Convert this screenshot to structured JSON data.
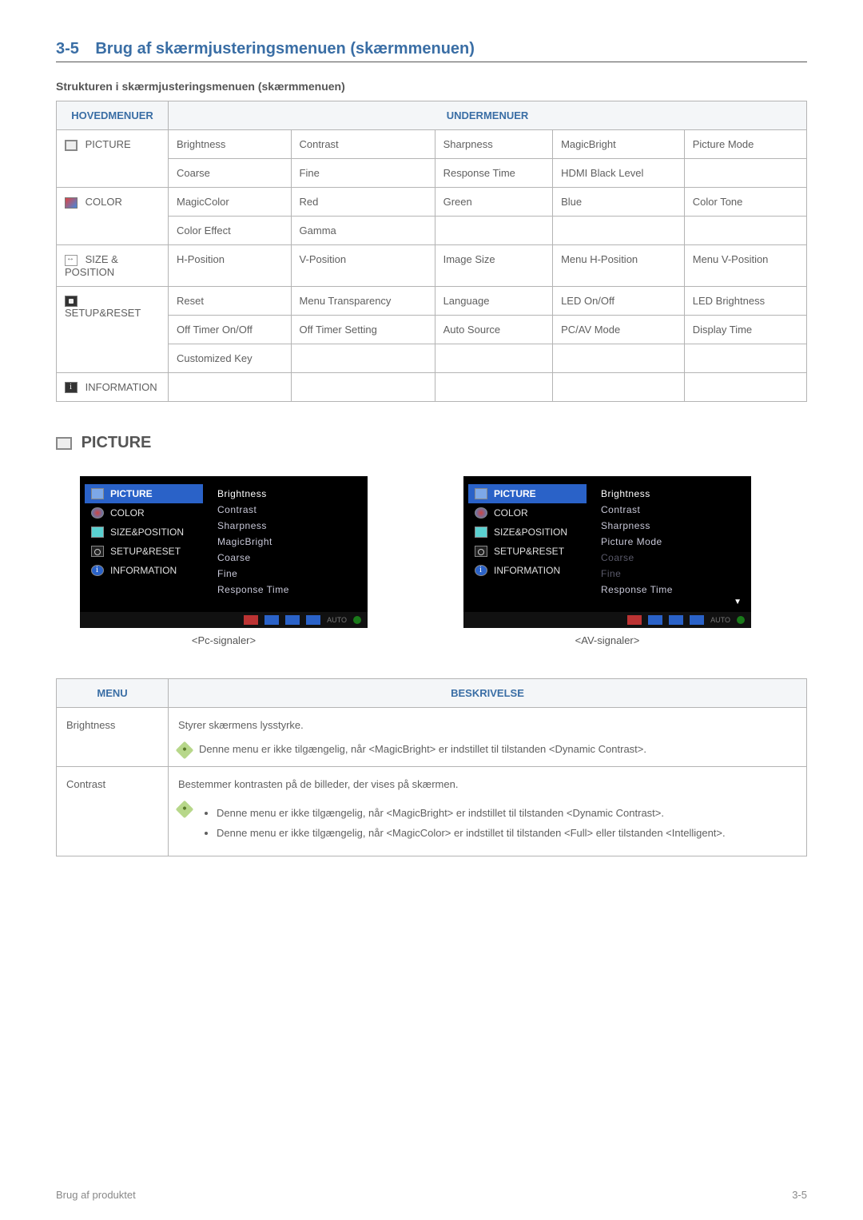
{
  "section": {
    "num": "3-5",
    "title": "Brug af skærmjusteringsmenuen (skærmmenuen)"
  },
  "subheading": "Strukturen i skærmjusteringsmenuen (skærmmenuen)",
  "table1": {
    "head": {
      "col1": "HOVEDMENUER",
      "col2": "UNDERMENUER"
    },
    "rows": {
      "picture_label": "PICTURE",
      "picture_r1": [
        "Brightness",
        "Contrast",
        "Sharpness",
        "MagicBright",
        "Picture Mode"
      ],
      "picture_r2": [
        "Coarse",
        "Fine",
        "Response Time",
        "HDMI Black Level",
        ""
      ],
      "color_label": "COLOR",
      "color_r1": [
        "MagicColor",
        "Red",
        "Green",
        "Blue",
        "Color Tone"
      ],
      "color_r2": [
        "Color Effect",
        "Gamma",
        "",
        "",
        ""
      ],
      "size_label": "SIZE & POSITION",
      "size_r1": [
        "H-Position",
        "V-Position",
        "Image Size",
        "Menu H-Position",
        "Menu V-Position"
      ],
      "setup_label": "SETUP&RESET",
      "setup_r1": [
        "Reset",
        "Menu Transparency",
        "Language",
        "LED On/Off",
        "LED Brightness"
      ],
      "setup_r2": [
        "Off Timer On/Off",
        "Off Timer Setting",
        "Auto Source",
        "PC/AV Mode",
        "Display Time"
      ],
      "setup_r3": [
        "Customized Key",
        "",
        "",
        "",
        ""
      ],
      "info_label": "INFORMATION",
      "info_r1": [
        "",
        "",
        "",
        "",
        ""
      ]
    }
  },
  "picture_heading": "PICTURE",
  "osd": {
    "left_items": [
      "PICTURE",
      "COLOR",
      "SIZE&POSITION",
      "SETUP&RESET",
      "INFORMATION"
    ],
    "pc_opts": [
      "Brightness",
      "Contrast",
      "Sharpness",
      "MagicBright",
      "Coarse",
      "Fine",
      "Response Time"
    ],
    "av_opts": [
      "Brightness",
      "Contrast",
      "Sharpness",
      "Picture Mode",
      "Coarse",
      "Fine",
      "Response Time"
    ],
    "av_dim_idx": [
      4,
      5
    ],
    "caption_pc": "<Pc-signaler>",
    "caption_av": "<AV-signaler>",
    "nav_auto": "AUTO"
  },
  "table2": {
    "head": {
      "col1": "MENU",
      "col2": "BESKRIVELSE"
    },
    "rows": [
      {
        "menu": "Brightness",
        "desc": "Styrer skærmens lysstyrke.",
        "note_single": "Denne menu er ikke tilgængelig, når <MagicBright> er indstillet til tilstanden <Dynamic Contrast>."
      },
      {
        "menu": "Contrast",
        "desc": "Bestemmer kontrasten på de billeder, der vises på skærmen.",
        "note_bullets": [
          "Denne menu er ikke tilgængelig, når <MagicBright> er indstillet til tilstanden <Dynamic Contrast>.",
          "Denne menu er ikke tilgængelig, når <MagicColor> er indstillet til tilstanden <Full> eller tilstanden <Intelligent>."
        ]
      }
    ]
  },
  "footer": {
    "left": "Brug af produktet",
    "right": "3-5"
  }
}
